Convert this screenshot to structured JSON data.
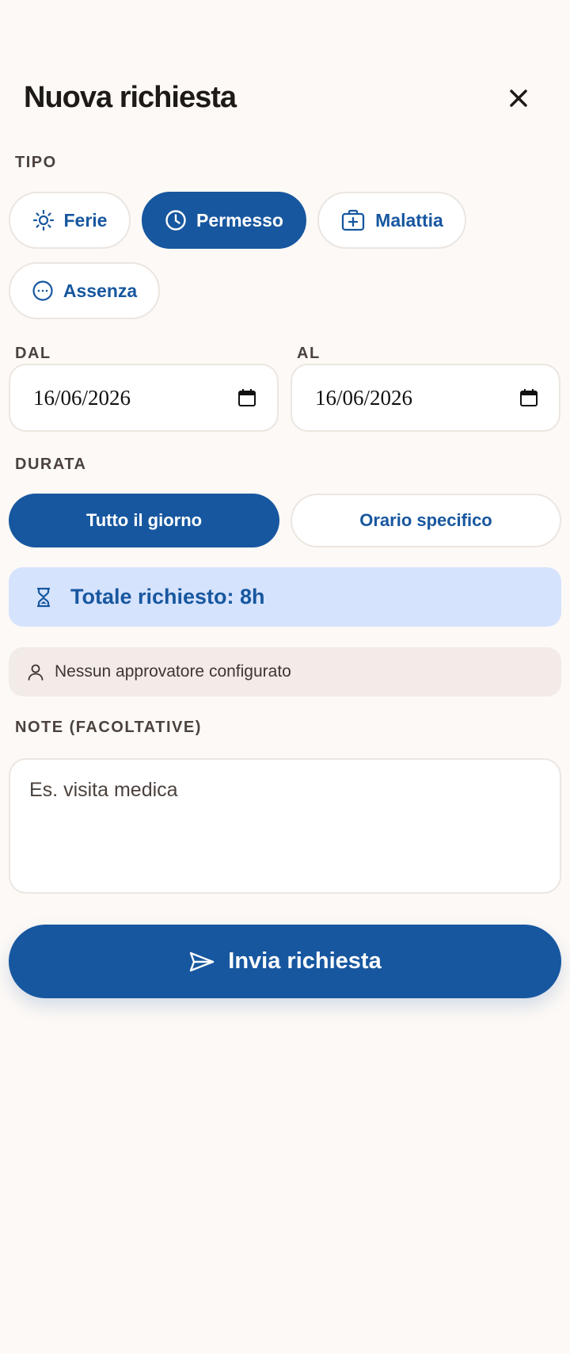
{
  "header": {
    "title": "Nuova richiesta"
  },
  "tipo": {
    "label": "TIPO",
    "options": [
      {
        "label": "Ferie",
        "icon": "sun-icon",
        "selected": false
      },
      {
        "label": "Permesso",
        "icon": "clock-icon",
        "selected": true
      },
      {
        "label": "Malattia",
        "icon": "medical-case-icon",
        "selected": false
      },
      {
        "label": "Assenza",
        "icon": "more-circle-icon",
        "selected": false
      }
    ]
  },
  "dates": {
    "from_label": "DAL",
    "from_value": "16/06/2026",
    "to_label": "AL",
    "to_value": "16/06/2026"
  },
  "durata": {
    "label": "DURATA",
    "options": [
      {
        "label": "Tutto il giorno",
        "selected": true
      },
      {
        "label": "Orario specifico",
        "selected": false
      }
    ]
  },
  "total": {
    "text": "Totale richiesto: 8h",
    "icon": "hourglass-icon"
  },
  "approver": {
    "text": "Nessun approvatore configurato",
    "icon": "user-icon"
  },
  "notes": {
    "label": "NOTE (FACOLTATIVE)",
    "placeholder": "Es. visita medica",
    "value": ""
  },
  "submit": {
    "label": "Invia richiesta",
    "icon": "send-icon"
  },
  "colors": {
    "accent": "#17579f",
    "background": "#fdf9f6",
    "info_bg": "#d6e3fd",
    "muted_bg": "#f2ebe7"
  }
}
